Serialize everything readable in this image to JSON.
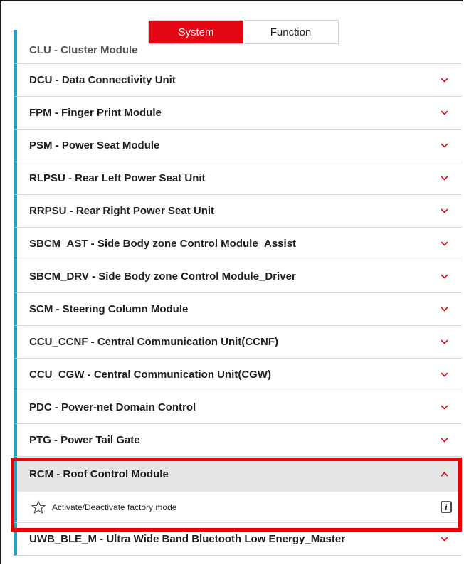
{
  "toggle": {
    "system_label": "System",
    "function_label": "Function"
  },
  "partial_item": {
    "label": "CLU - Cluster Module"
  },
  "items": [
    {
      "label": "DCU - Data Connectivity Unit"
    },
    {
      "label": "FPM - Finger Print Module"
    },
    {
      "label": "PSM - Power Seat Module"
    },
    {
      "label": "RLPSU - Rear Left Power Seat Unit"
    },
    {
      "label": "RRPSU - Rear Right Power Seat Unit"
    },
    {
      "label": "SBCM_AST - Side Body zone Control Module_Assist"
    },
    {
      "label": "SBCM_DRV - Side Body zone Control Module_Driver"
    },
    {
      "label": "SCM - Steering Column Module"
    },
    {
      "label": "CCU_CCNF - Central Communication Unit(CCNF)"
    },
    {
      "label": "CCU_CGW - Central Communication Unit(CGW)"
    },
    {
      "label": "PDC - Power-net Domain Control"
    },
    {
      "label": "PTG - Power Tail Gate"
    }
  ],
  "expanded_item": {
    "label": "RCM - Roof Control Module",
    "function": {
      "label": "Activate/Deactivate factory mode"
    }
  },
  "last_item": {
    "label": "UWB_BLE_M - Ultra Wide Band Bluetooth Low Energy_Master"
  },
  "colors": {
    "accent_red": "#e30613",
    "list_bar_blue": "#1aa6c9",
    "highlight_red": "#ee0000",
    "expanded_bg": "#e6e6e6"
  },
  "icons": {
    "collapsed": "chevron-down-icon",
    "expanded": "chevron-up-icon",
    "favorite": "star-outline-icon",
    "info": "info-icon"
  }
}
